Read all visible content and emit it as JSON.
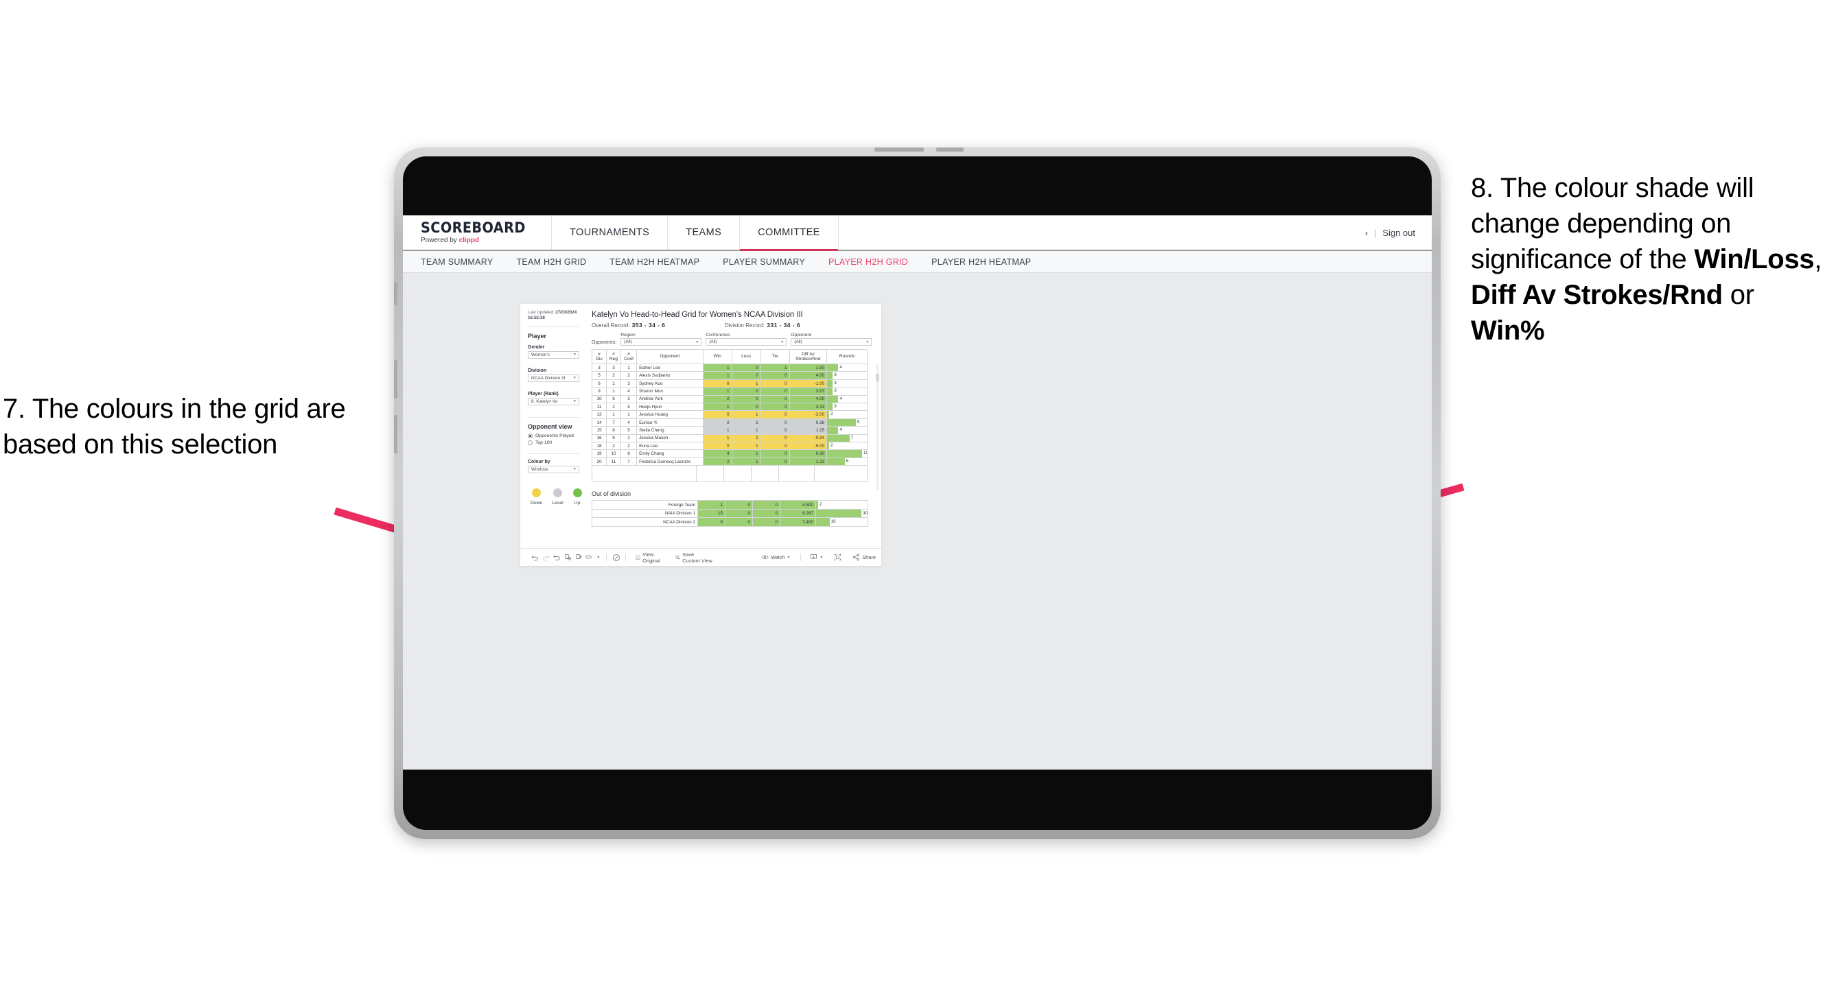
{
  "annotations": {
    "left": {
      "number": "7.",
      "text": "7. The colours in the grid are based on this selection"
    },
    "right": {
      "parts": [
        {
          "text": "8. The colour shade will change depending on significance of the ",
          "bold": false
        },
        {
          "text": "Win/Loss",
          "bold": true
        },
        {
          "text": ", ",
          "bold": false
        },
        {
          "text": "Diff Av Strokes/Rnd",
          "bold": true
        },
        {
          "text": " or ",
          "bold": false
        },
        {
          "text": "Win%",
          "bold": true
        }
      ]
    },
    "arrow_color": "#ED2C60"
  },
  "topnav": {
    "logo_main": "SCOREBOARD",
    "logo_sub_prefix": "Powered by ",
    "logo_sub_brand": "clippd",
    "items": [
      {
        "label": "TOURNAMENTS",
        "active": false
      },
      {
        "label": "TEAMS",
        "active": false
      },
      {
        "label": "COMMITTEE",
        "active": true
      }
    ],
    "chevron": "›",
    "separator": "|",
    "sign_out": "Sign out"
  },
  "subnav": {
    "items": [
      {
        "label": "TEAM SUMMARY",
        "active": false
      },
      {
        "label": "TEAM H2H GRID",
        "active": false
      },
      {
        "label": "TEAM H2H HEATMAP",
        "active": false
      },
      {
        "label": "PLAYER SUMMARY",
        "active": false
      },
      {
        "label": "PLAYER H2H GRID",
        "active": true
      },
      {
        "label": "PLAYER H2H HEATMAP",
        "active": false
      }
    ],
    "active_color": "#e8436c"
  },
  "panel": {
    "last_updated_label": "Last Updated:",
    "last_updated_date": "27/03/2024",
    "last_updated_time": "16:55:38",
    "heading": "Player",
    "fields": [
      {
        "label": "Gender",
        "value": "Women’s"
      },
      {
        "label": "Division",
        "value": "NCAA Division III"
      },
      {
        "label": "Player (Rank)",
        "value": "8. Katelyn Vo"
      }
    ],
    "opponent_view": {
      "heading": "Opponent view",
      "options": [
        {
          "label": "Opponents Played",
          "selected": true
        },
        {
          "label": "Top 100",
          "selected": false
        }
      ]
    },
    "colour_by": {
      "label": "Colour by",
      "value": "Win/loss"
    },
    "legend": [
      {
        "label": "Down",
        "color": "#F2D04B"
      },
      {
        "label": "Level",
        "color": "#C8CBCF"
      },
      {
        "label": "Up",
        "color": "#76C14A"
      }
    ]
  },
  "view": {
    "title": "Katelyn Vo Head-to-Head Grid for Women’s NCAA Division III",
    "overall_record_label": "Overall Record:",
    "overall_record_value": "353 -  34 - 6",
    "division_record_label": "Division Record:",
    "division_record_value": "331 -  34 - 6",
    "opponents_label": "Opponents:",
    "filters": [
      {
        "label": "Region",
        "value": "(All)"
      },
      {
        "label": "Conference",
        "value": "(All)"
      },
      {
        "label": "Opponent",
        "value": "(All)"
      }
    ]
  },
  "chart_data": {
    "type": "table",
    "title": "Katelyn Vo Head-to-Head Grid for Women’s NCAA Division III",
    "columns": [
      "# Div",
      "# Reg",
      "# Conf",
      "Opponent",
      "Win",
      "Loss",
      "Tie",
      "Diff Av Strokes/Rnd",
      "Rounds"
    ],
    "header_lines": [
      [
        "#",
        "Div"
      ],
      [
        "#",
        "Reg"
      ],
      [
        "#",
        "Conf"
      ],
      [
        "Opponent"
      ],
      [
        "Win"
      ],
      [
        "Loss"
      ],
      [
        "Tie"
      ],
      [
        "Diff Av",
        "Strokes/Rnd"
      ],
      [
        "Rounds"
      ]
    ],
    "colors": {
      "up": "#9BCF72",
      "down": "#F5D659",
      "level": "#CFD1D3",
      "rounds_bar": "#9BCF72"
    },
    "rows": [
      {
        "div": "3",
        "reg": "3",
        "conf": "1",
        "opponent": "Esther Lee",
        "win": "1",
        "loss": "0",
        "tie": "1",
        "diff": "1.50",
        "rounds": "4",
        "shade": "up",
        "rounds_pct": 28
      },
      {
        "div": "5",
        "reg": "2",
        "conf": "2",
        "opponent": "Alexis Sudjianto",
        "win": "1",
        "loss": "0",
        "tie": "0",
        "diff": "4.00",
        "rounds": "3",
        "shade": "up",
        "rounds_pct": 14
      },
      {
        "div": "6",
        "reg": "1",
        "conf": "3",
        "opponent": "Sydney Kuo",
        "win": "0",
        "loss": "1",
        "tie": "0",
        "diff": "-1.00",
        "rounds": "3",
        "shade": "down",
        "rounds_pct": 14
      },
      {
        "div": "9",
        "reg": "1",
        "conf": "4",
        "opponent": "Sharon Mun",
        "win": "1",
        "loss": "0",
        "tie": "0",
        "diff": "3.67",
        "rounds": "3",
        "shade": "up",
        "rounds_pct": 14
      },
      {
        "div": "10",
        "reg": "6",
        "conf": "3",
        "opponent": "Andrea York",
        "win": "2",
        "loss": "0",
        "tie": "0",
        "diff": "4.00",
        "rounds": "4",
        "shade": "up",
        "rounds_pct": 28
      },
      {
        "div": "11",
        "reg": "2",
        "conf": "5",
        "opponent": "Heejo Hyun",
        "win": "1",
        "loss": "0",
        "tie": "0",
        "diff": "3.33",
        "rounds": "3",
        "shade": "up",
        "rounds_pct": 14
      },
      {
        "div": "13",
        "reg": "1",
        "conf": "1",
        "opponent": "Jessica Huang",
        "win": "0",
        "loss": "1",
        "tie": "0",
        "diff": "-3.00",
        "rounds": "2",
        "shade": "down",
        "rounds_pct": 5
      },
      {
        "div": "14",
        "reg": "7",
        "conf": "4",
        "opponent": "Eunice Yi",
        "win": "2",
        "loss": "2",
        "tie": "0",
        "diff": "0.38",
        "rounds": "9",
        "shade": "level",
        "rounds_pct": 72
      },
      {
        "div": "15",
        "reg": "8",
        "conf": "5",
        "opponent": "Stella Cheng",
        "win": "1",
        "loss": "1",
        "tie": "0",
        "diff": "1.25",
        "rounds": "4",
        "shade": "level",
        "rounds_pct": 28
      },
      {
        "div": "16",
        "reg": "9",
        "conf": "1",
        "opponent": "Jessica Mason",
        "win": "1",
        "loss": "2",
        "tie": "0",
        "diff": "-0.94",
        "rounds": "7",
        "shade": "down",
        "rounds_pct": 56
      },
      {
        "div": "18",
        "reg": "2",
        "conf": "2",
        "opponent": "Euna Lee",
        "win": "0",
        "loss": "1",
        "tie": "0",
        "diff": "-5.00",
        "rounds": "2",
        "shade": "down",
        "rounds_pct": 5
      },
      {
        "div": "19",
        "reg": "10",
        "conf": "6",
        "opponent": "Emily Chang",
        "win": "4",
        "loss": "1",
        "tie": "0",
        "diff": "0.30",
        "rounds": "11",
        "shade": "up",
        "rounds_pct": 88
      },
      {
        "div": "20",
        "reg": "11",
        "conf": "7",
        "opponent": "Federica Domecq Lacroze",
        "win": "2",
        "loss": "1",
        "tie": "0",
        "diff": "1.33",
        "rounds": "6",
        "shade": "up",
        "rounds_pct": 44
      }
    ],
    "out_of_division": {
      "title": "Out of division",
      "rows": [
        {
          "opponent": "Foreign Team",
          "win": "1",
          "loss": "0",
          "tie": "0",
          "diff": "4.500",
          "rounds": "2",
          "shade": "up",
          "rounds_pct": 4
        },
        {
          "opponent": "NAIA Division 1",
          "win": "15",
          "loss": "0",
          "tie": "0",
          "diff": "9.267",
          "rounds": "30",
          "shade": "up",
          "rounds_pct": 88
        },
        {
          "opponent": "NCAA Division 2",
          "win": "5",
          "loss": "0",
          "tie": "0",
          "diff": "7.400",
          "rounds": "10",
          "shade": "up",
          "rounds_pct": 26
        }
      ]
    }
  },
  "toolbar": {
    "icons": [
      "undo-icon",
      "redo-icon",
      "revert-icon",
      "refresh-icon",
      "pause-icon",
      "highlight-icon"
    ],
    "view_label": "View: Original",
    "save_label": "Save Custom View",
    "watch_label": "Watch",
    "share_label": "Share",
    "alerts_icon": "alerts-icon",
    "download_icon": "download-icon",
    "fullscreen_icon": "fullscreen-icon"
  }
}
